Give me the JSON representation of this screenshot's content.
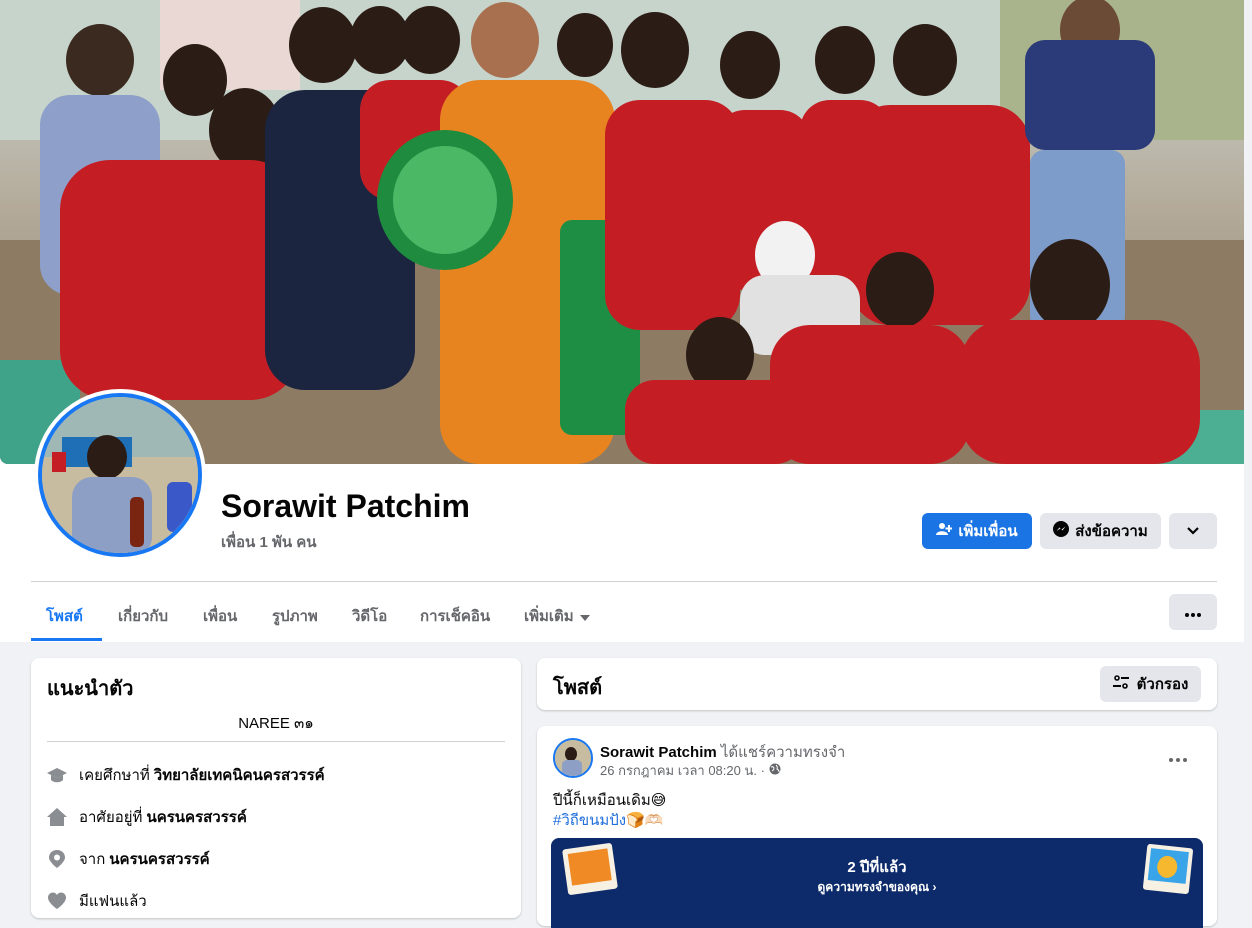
{
  "profile": {
    "name": "Sorawit Patchim",
    "friends": "เพื่อน 1 พัน คน"
  },
  "actions": {
    "add_friend": "เพิ่มเพื่อน",
    "message": "ส่งข้อความ"
  },
  "tabs": [
    {
      "label": "โพสต์",
      "active": true
    },
    {
      "label": "เกี่ยวกับ"
    },
    {
      "label": "เพื่อน"
    },
    {
      "label": "รูปภาพ"
    },
    {
      "label": "วิดีโอ"
    },
    {
      "label": "การเช็คอิน"
    },
    {
      "label": "เพิ่มเติม"
    }
  ],
  "intro": {
    "title": "แนะนำตัว",
    "bio": "NAREE ๓๑",
    "items": [
      {
        "icon": "graduation-cap-icon",
        "prefix": "เคยศึกษาที่",
        "value": "วิทยาลัยเทคนิคนครสวรรค์"
      },
      {
        "icon": "home-icon",
        "prefix": "อาศัยอยู่ที่",
        "value": "นครนครสวรรค์"
      },
      {
        "icon": "location-pin-icon",
        "prefix": "จาก",
        "value": "นครนครสวรรค์"
      },
      {
        "icon": "heart-icon",
        "prefix": "มีแฟนแล้ว",
        "value": ""
      }
    ]
  },
  "posts_section": {
    "title": "โพสต์",
    "filter": "ตัวกรอง"
  },
  "post": {
    "author": "Sorawit Patchim",
    "action": "ได้แชร์ความทรงจำ",
    "time": "26 กรกฎาคม เวลา 08:20 น. ·",
    "text": "ปีนี้ก็เหมือนเดิม😅",
    "hashtag": "#วิถีขนมปัง🍞🫶🏻",
    "memory_title": "2 ปีที่แล้ว",
    "memory_link": "ดูความทรงจำของคุณ ›"
  },
  "colors": {
    "accent": "#1877f2",
    "primary_button": "#1b74e4",
    "grey_button": "#e4e6eb",
    "page_bg": "#f0f2f5",
    "memory_bg": "#0d2b6b"
  }
}
